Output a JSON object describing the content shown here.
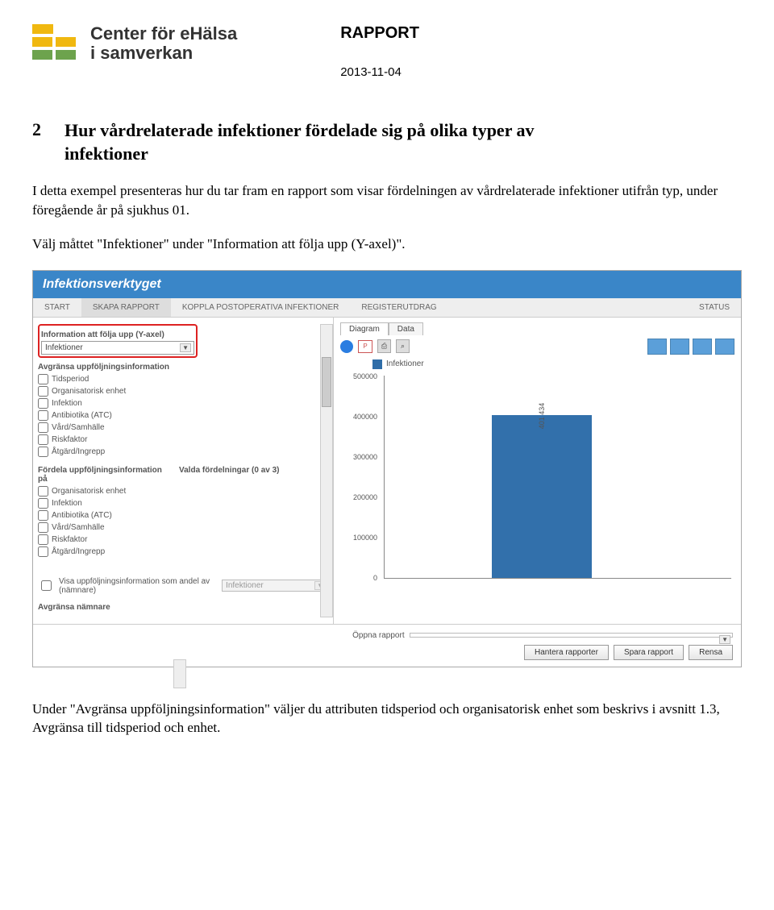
{
  "header": {
    "logo_line1": "Center för eHälsa",
    "logo_line2": "i samverkan",
    "rapport": "RAPPORT",
    "date": "2013-11-04"
  },
  "doc": {
    "sec_num": "2",
    "sec_title_l1": "Hur vårdrelaterade infektioner fördelade sig på olika typer av",
    "sec_title_l2": "infektioner",
    "para1": "I detta exempel presenteras hur du tar fram en rapport som visar fördelningen av vårdrelaterade infektioner utifrån typ, under föregående år på sjukhus 01.",
    "para2": "Välj måttet \"Infektioner\" under \"Information att följa upp (Y-axel)\".",
    "para3": "Under \"Avgränsa uppföljningsinformation\" väljer du attributen tidsperiod och organisatorisk enhet som beskrivs i avsnitt 1.3, Avgränsa till tidsperiod och enhet."
  },
  "app": {
    "title": "Infektionsverktyget",
    "nav": {
      "start": "START",
      "skapa": "SKAPA RAPPORT",
      "koppla": "KOPPLA POSTOPERATIVA INFEKTIONER",
      "register": "REGISTERUTDRAG",
      "status": "STATUS"
    },
    "left": {
      "info_label": "Information att följa upp (Y-axel)",
      "info_value": "Infektioner",
      "avgransa": "Avgränsa uppföljningsinformation",
      "items": [
        "Tidsperiod",
        "Organisatorisk enhet",
        "Infektion",
        "Antibiotika (ATC)",
        "Vård/Samhälle",
        "Riskfaktor",
        "Åtgärd/Ingrepp"
      ],
      "fordela": "Fördela uppföljningsinformation på",
      "valda": "Valda fördelningar (0 av 3)",
      "fordela_items": [
        "Organisatorisk enhet",
        "Infektion",
        "Antibiotika (ATC)",
        "Vård/Samhälle",
        "Riskfaktor",
        "Åtgärd/Ingrepp"
      ],
      "andel_label": "Visa uppföljningsinformation som andel av (nämnare)",
      "andel_value": "Infektioner",
      "avg_namnare": "Avgränsa nämnare"
    },
    "right": {
      "tab_diagram": "Diagram",
      "tab_data": "Data",
      "ppt": "P",
      "print": "⎙",
      "zoom": "⌕",
      "legend": "Infektioner",
      "yticks": [
        "500000",
        "400000",
        "300000",
        "200000",
        "100000",
        "0"
      ],
      "bar_value_label": "401 434"
    },
    "footer": {
      "open": "Öppna rapport",
      "hantera": "Hantera rapporter",
      "spara": "Spara rapport",
      "rensa": "Rensa"
    }
  },
  "chart_data": {
    "type": "bar",
    "categories": [
      ""
    ],
    "values": [
      401434
    ],
    "title": "",
    "xlabel": "",
    "ylabel": "",
    "ylim": [
      0,
      500000
    ],
    "series": [
      {
        "name": "Infektioner",
        "values": [
          401434
        ]
      }
    ]
  }
}
